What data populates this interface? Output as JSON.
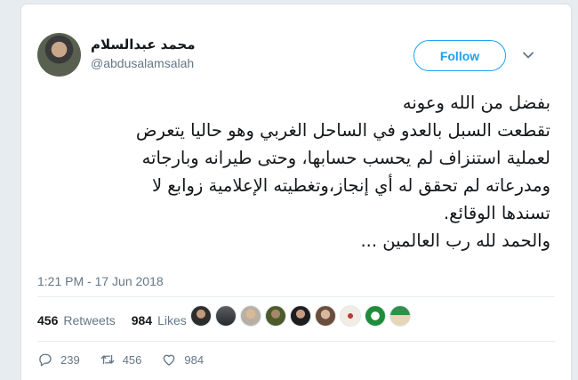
{
  "tweet": {
    "display_name": "محمد عبدالسلام",
    "handle": "@abdusalamsalah",
    "follow_label": "Follow",
    "text_lines": [
      "بفضل من الله وعونه",
      "تقطعت السبل بالعدو في الساحل الغربي وهو حاليا يتعرض",
      "لعملية استنزاف لم يحسب حسابها، وحتى طيرانه وبارجاته",
      "ومدرعاته لم تحقق له أي إنجاز،وتغطيته الإعلامية زوابع لا",
      "تسندها الوقائع.",
      "والحمد لله رب العالمين ..."
    ],
    "timestamp": "1:21 PM - 17 Jun 2018"
  },
  "stats": {
    "retweets_count": "456",
    "retweets_label": "Retweets",
    "likes_count": "984",
    "likes_label": "Likes"
  },
  "actions": {
    "reply_count": "239",
    "retweet_count": "456",
    "like_count": "984"
  },
  "icons": {
    "caret": "chevron-down-icon",
    "reply": "reply-icon",
    "retweet": "retweet-icon",
    "like": "heart-icon"
  },
  "colors": {
    "accent": "#1da1f2",
    "text": "#14171a",
    "muted": "#657786",
    "background": "#e6ecf0"
  }
}
